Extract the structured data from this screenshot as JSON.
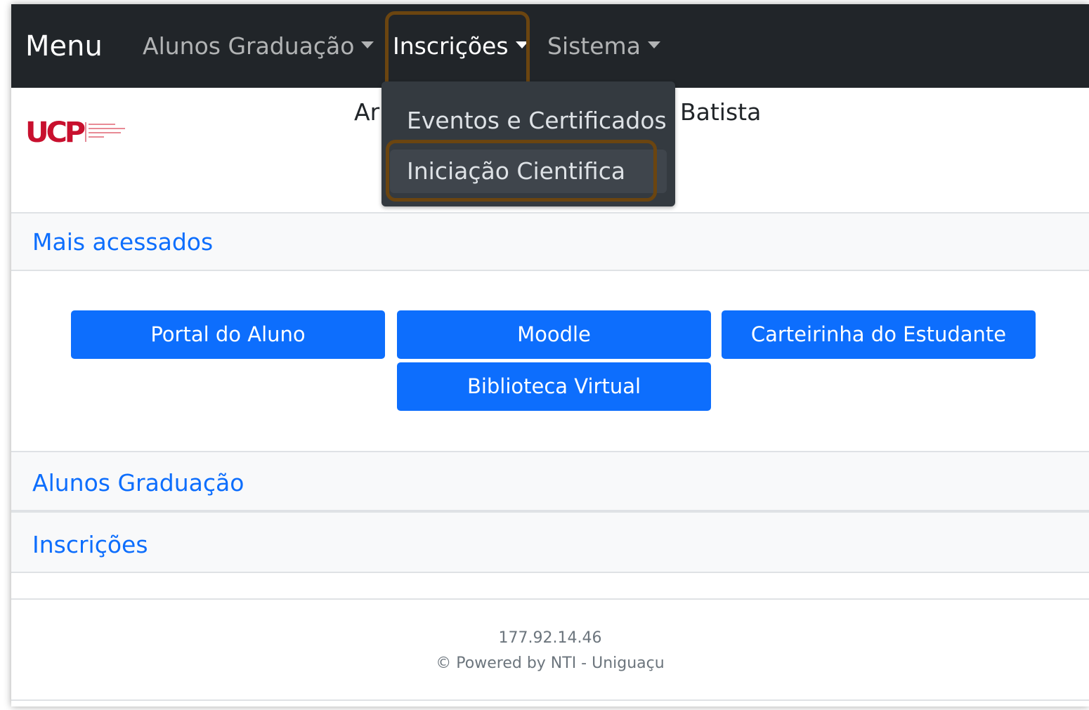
{
  "navbar": {
    "brand": "Menu",
    "items": [
      {
        "label": "Alunos Graduação"
      },
      {
        "label": "Inscrições"
      },
      {
        "label": "Sistema"
      }
    ]
  },
  "logo": {
    "text": "UCP"
  },
  "header_partial": {
    "left": "Ar",
    "right": "Batista"
  },
  "dropdown": {
    "items": [
      {
        "label": "Eventos e Certificados"
      },
      {
        "label": "Iniciação Cientifica"
      }
    ]
  },
  "sections": {
    "most_accessed": "Mais acessados",
    "graduation": "Alunos Graduação",
    "registrations": "Inscrições"
  },
  "quick_links": [
    {
      "label": "Portal do Aluno"
    },
    {
      "label": "Moodle"
    },
    {
      "label": "Carteirinha do Estudante"
    },
    {
      "label": "Biblioteca Virtual"
    }
  ],
  "footer": {
    "ip": "177.92.14.46",
    "powered": "© Powered by NTI - Uniguaçu"
  },
  "colors": {
    "navbar": "#212529",
    "primary": "#0d6efd",
    "highlight": "#6b4510",
    "logo_red": "#c8102e"
  }
}
